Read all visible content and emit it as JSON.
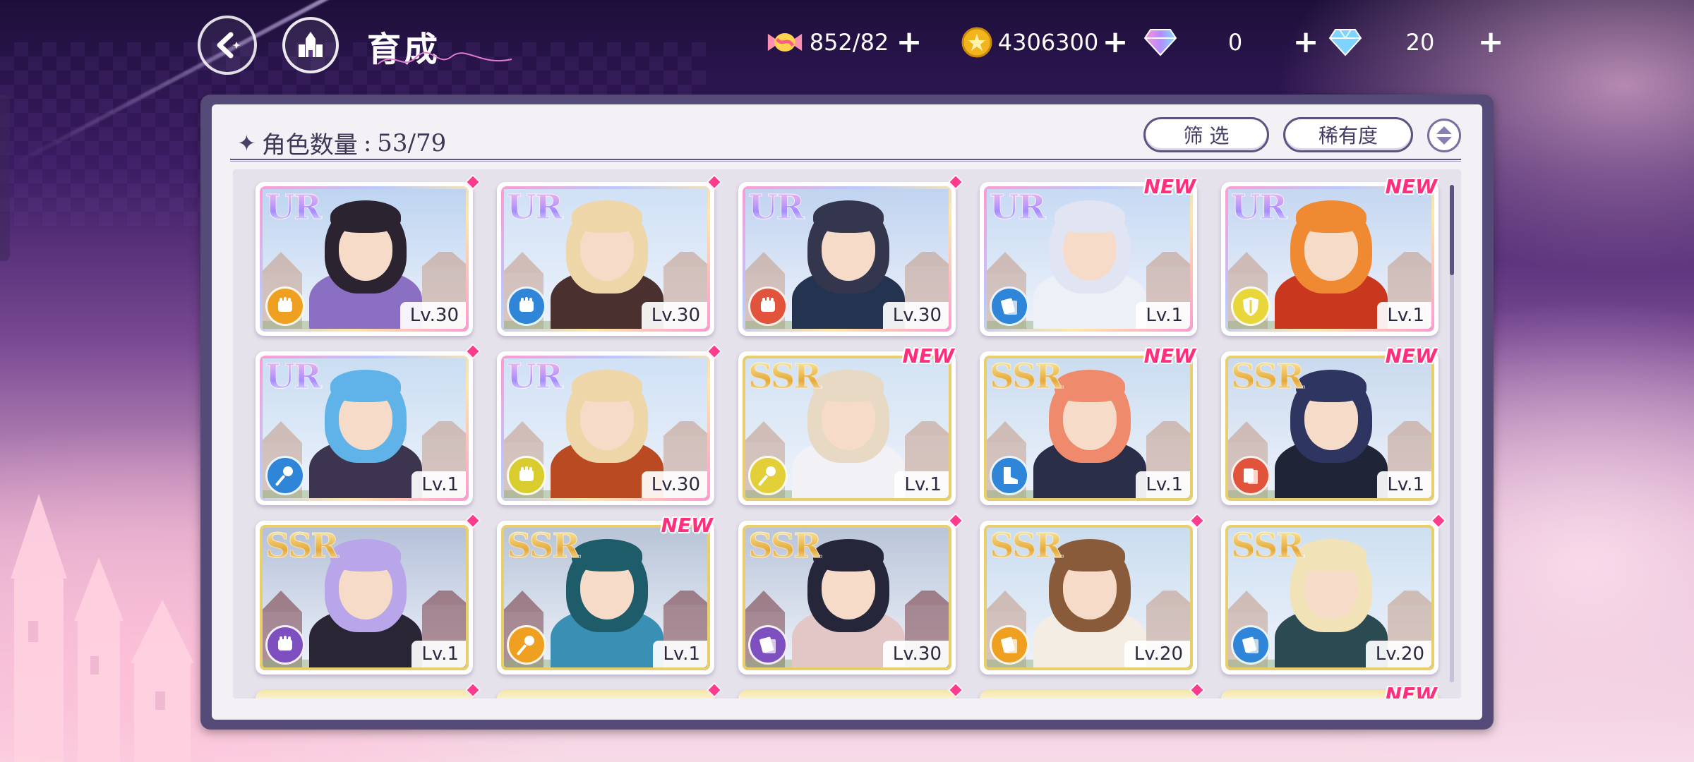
{
  "header": {
    "title": "育成",
    "back_icon": "back-arrow-icon",
    "home_icon": "castle-icon"
  },
  "currencies": [
    {
      "id": "candy",
      "icon": "candy-icon",
      "value": "852/82",
      "color": "#ff8fb1"
    },
    {
      "id": "coin",
      "icon": "gold-coin-icon",
      "value": "4306300",
      "color": "#f2b51d"
    },
    {
      "id": "gem-rainbow",
      "icon": "rainbow-diamond-icon",
      "value": "0",
      "color": "#c79bff"
    },
    {
      "id": "gem-blue",
      "icon": "blue-diamond-icon",
      "value": "20",
      "color": "#7fd4ff"
    }
  ],
  "panel": {
    "count_label": "角色数量",
    "count_value": "53/79",
    "filter_label": "筛 选",
    "rarity_label": "稀有度"
  },
  "cards": [
    {
      "rarity": "UR",
      "level": "Lv.30",
      "badge_color": "#f0a020",
      "badge_icon": "fist-icon",
      "tag": "dot",
      "hair": "#2b2330",
      "outfit": "#8b6fc2",
      "sky": "#bcd3f0"
    },
    {
      "rarity": "UR",
      "level": "Lv.30",
      "badge_color": "#2f86d8",
      "badge_icon": "fist-icon",
      "tag": "dot",
      "hair": "#efd6a8",
      "outfit": "#4a3130",
      "sky": "#cfe0f5"
    },
    {
      "rarity": "UR",
      "level": "Lv.30",
      "badge_color": "#e2533b",
      "badge_icon": "fist-icon",
      "tag": "dot",
      "hair": "#34364e",
      "outfit": "#243350",
      "sky": "#bfd2ef"
    },
    {
      "rarity": "UR",
      "level": "Lv.1",
      "badge_color": "#2f86d8",
      "badge_icon": "book-icon",
      "tag": "NEW",
      "hair": "#e1e4f2",
      "outfit": "#eef0f8",
      "sky": "#c6d9f3"
    },
    {
      "rarity": "UR",
      "level": "Lv.1",
      "badge_color": "#e8d63a",
      "badge_icon": "shield-icon",
      "tag": "NEW",
      "hair": "#f08a32",
      "outfit": "#c9371f",
      "sky": "#c4d6f1"
    },
    {
      "rarity": "UR",
      "level": "Lv.1",
      "badge_color": "#2f86d8",
      "badge_icon": "wand-icon",
      "tag": "dot",
      "hair": "#5fb3e8",
      "outfit": "#3d3450",
      "sky": "#c9ddf2"
    },
    {
      "rarity": "UR",
      "level": "Lv.30",
      "badge_color": "#d9cc2e",
      "badge_icon": "fist-icon",
      "tag": "dot",
      "hair": "#efd6a8",
      "outfit": "#b94a22",
      "sky": "#cfe0f5"
    },
    {
      "rarity": "SSR",
      "level": "Lv.1",
      "badge_color": "#e3cf38",
      "badge_icon": "wand-icon",
      "tag": "NEW",
      "hair": "#e7d9c3",
      "outfit": "#f1f1f6",
      "sky": "#d2e2f3"
    },
    {
      "rarity": "SSR",
      "level": "Lv.1",
      "badge_color": "#2f86d8",
      "badge_icon": "boot-icon",
      "tag": "NEW",
      "hair": "#ef8a6c",
      "outfit": "#2a2e48",
      "sky": "#cadcf0"
    },
    {
      "rarity": "SSR",
      "level": "Lv.1",
      "badge_color": "#e2533b",
      "badge_icon": "card-icon",
      "tag": "NEW",
      "hair": "#2e3560",
      "outfit": "#1f2436",
      "sky": "#c9d9ee"
    },
    {
      "rarity": "SSR",
      "level": "Lv.1",
      "badge_color": "#7d4fbf",
      "badge_icon": "fist-icon",
      "tag": "dot",
      "hair": "#b9a6ea",
      "outfit": "#2a2535",
      "sky": "#b4c0d8"
    },
    {
      "rarity": "SSR",
      "level": "Lv.1",
      "badge_color": "#f0a020",
      "badge_icon": "wand-icon",
      "tag": "NEW",
      "hair": "#1f5c6a",
      "outfit": "#3a8fb4",
      "sky": "#b7c3d6"
    },
    {
      "rarity": "SSR",
      "level": "Lv.30",
      "badge_color": "#7d4fbf",
      "badge_icon": "book-icon",
      "tag": "dot",
      "hair": "#26263a",
      "outfit": "#e3c7c7",
      "sky": "#b9c4d8"
    },
    {
      "rarity": "SSR",
      "level": "Lv.20",
      "badge_color": "#f0a020",
      "badge_icon": "book-icon",
      "tag": "dot",
      "hair": "#8a5b3a",
      "outfit": "#f3ede4",
      "sky": "#c9dcef"
    },
    {
      "rarity": "SSR",
      "level": "Lv.20",
      "badge_color": "#2f86d8",
      "badge_icon": "book-icon",
      "tag": "dot",
      "hair": "#f1e2b8",
      "outfit": "#2b4a52",
      "sky": "#cddff1"
    }
  ],
  "partial_row_tags": [
    "dot",
    "dot",
    "dot",
    "dot",
    "NEW"
  ]
}
